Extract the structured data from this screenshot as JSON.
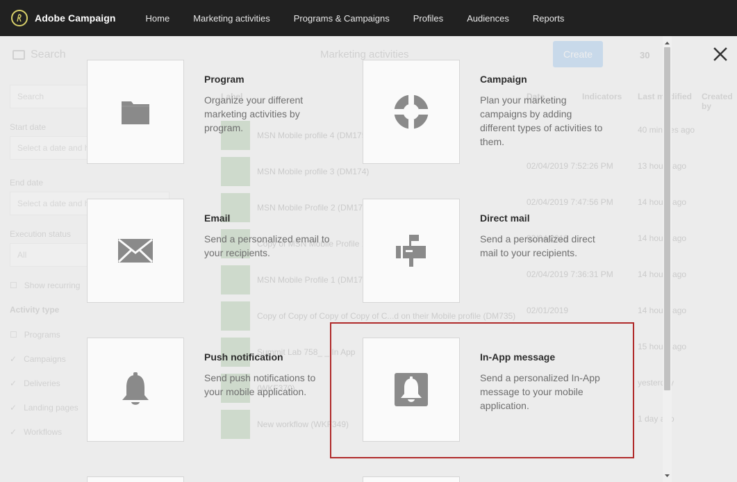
{
  "app": {
    "name": "Adobe Campaign"
  },
  "nav": [
    "Home",
    "Marketing activities",
    "Programs & Campaigns",
    "Profiles",
    "Audiences",
    "Reports"
  ],
  "background": {
    "search_label": "Search",
    "view_title": "Marketing activities",
    "create_label": "Create",
    "count": "30",
    "filters": {
      "search_placeholder": "Search",
      "start_date_label": "Start date",
      "start_date_placeholder": "Select a date and hour",
      "end_date_label": "End date",
      "end_date_placeholder": "Select a date and hour",
      "execution_status_label": "Execution status",
      "execution_status_value": "All",
      "show_recurring": "Show recurring",
      "activity_type_label": "Activity type",
      "activity_types": [
        "Programs",
        "Campaigns",
        "Deliveries",
        "Landing pages",
        "Workflows"
      ]
    },
    "table": {
      "headers": [
        "Label",
        "Date",
        "Indicators",
        "Last modified",
        "Created by"
      ],
      "rows": [
        {
          "label": "MSN Mobile profile 4 (DM175)",
          "date": "",
          "modified": "40 minutes ago"
        },
        {
          "label": "MSN Mobile profile 3 (DM174)",
          "date": "02/04/2019 7:52:26 PM",
          "modified": "13 hours ago"
        },
        {
          "label": "MSN Mobile Profile 2 (DM174)",
          "date": "02/04/2019 7:47:56 PM",
          "modified": "14 hours ago"
        },
        {
          "label": "Copy of MSN Mobile Profile 1",
          "date": "02/04/2019",
          "modified": "14 hours ago"
        },
        {
          "label": "MSN Mobile Profile 1 (DM174)",
          "date": "02/04/2019 7:36:31 PM",
          "modified": "14 hours ago"
        },
        {
          "label": "Copy of Copy of Copy of Copy of C...d on their Mobile profile (DM735)",
          "date": "02/01/2019",
          "modified": "14 hours ago"
        },
        {
          "label": "Summit Lab 758_ _ In App",
          "date": "",
          "modified": "15 hours ago"
        },
        {
          "label": "(WKF370)",
          "date": "",
          "modified": "yesterday"
        },
        {
          "label": "New workflow (WKF349)",
          "date": "",
          "modified": "1 day ago"
        }
      ]
    }
  },
  "cards": [
    {
      "id": "program",
      "title": "Program",
      "desc": "Organize your different marketing activities by program.",
      "icon": "folder-icon"
    },
    {
      "id": "campaign",
      "title": "Campaign",
      "desc": "Plan your marketing campaigns by adding different types of activities to them.",
      "icon": "lifebuoy-icon"
    },
    {
      "id": "email",
      "title": "Email",
      "desc": "Send a personalized email to your recipients.",
      "icon": "envelope-icon"
    },
    {
      "id": "direct-mail",
      "title": "Direct mail",
      "desc": "Send a personalized direct mail to your recipients.",
      "icon": "mailbox-icon"
    },
    {
      "id": "push-notification",
      "title": "Push notification",
      "desc": "Send push notifications to your mobile application.",
      "icon": "bell-icon"
    },
    {
      "id": "in-app-message",
      "title": "In-App message",
      "desc": "Send a personalized In-App message to your mobile application.",
      "icon": "bell-square-icon"
    }
  ],
  "colors": {
    "topbar": "#212121",
    "highlight": "#b02a2a",
    "icon": "#8a8a8a"
  }
}
